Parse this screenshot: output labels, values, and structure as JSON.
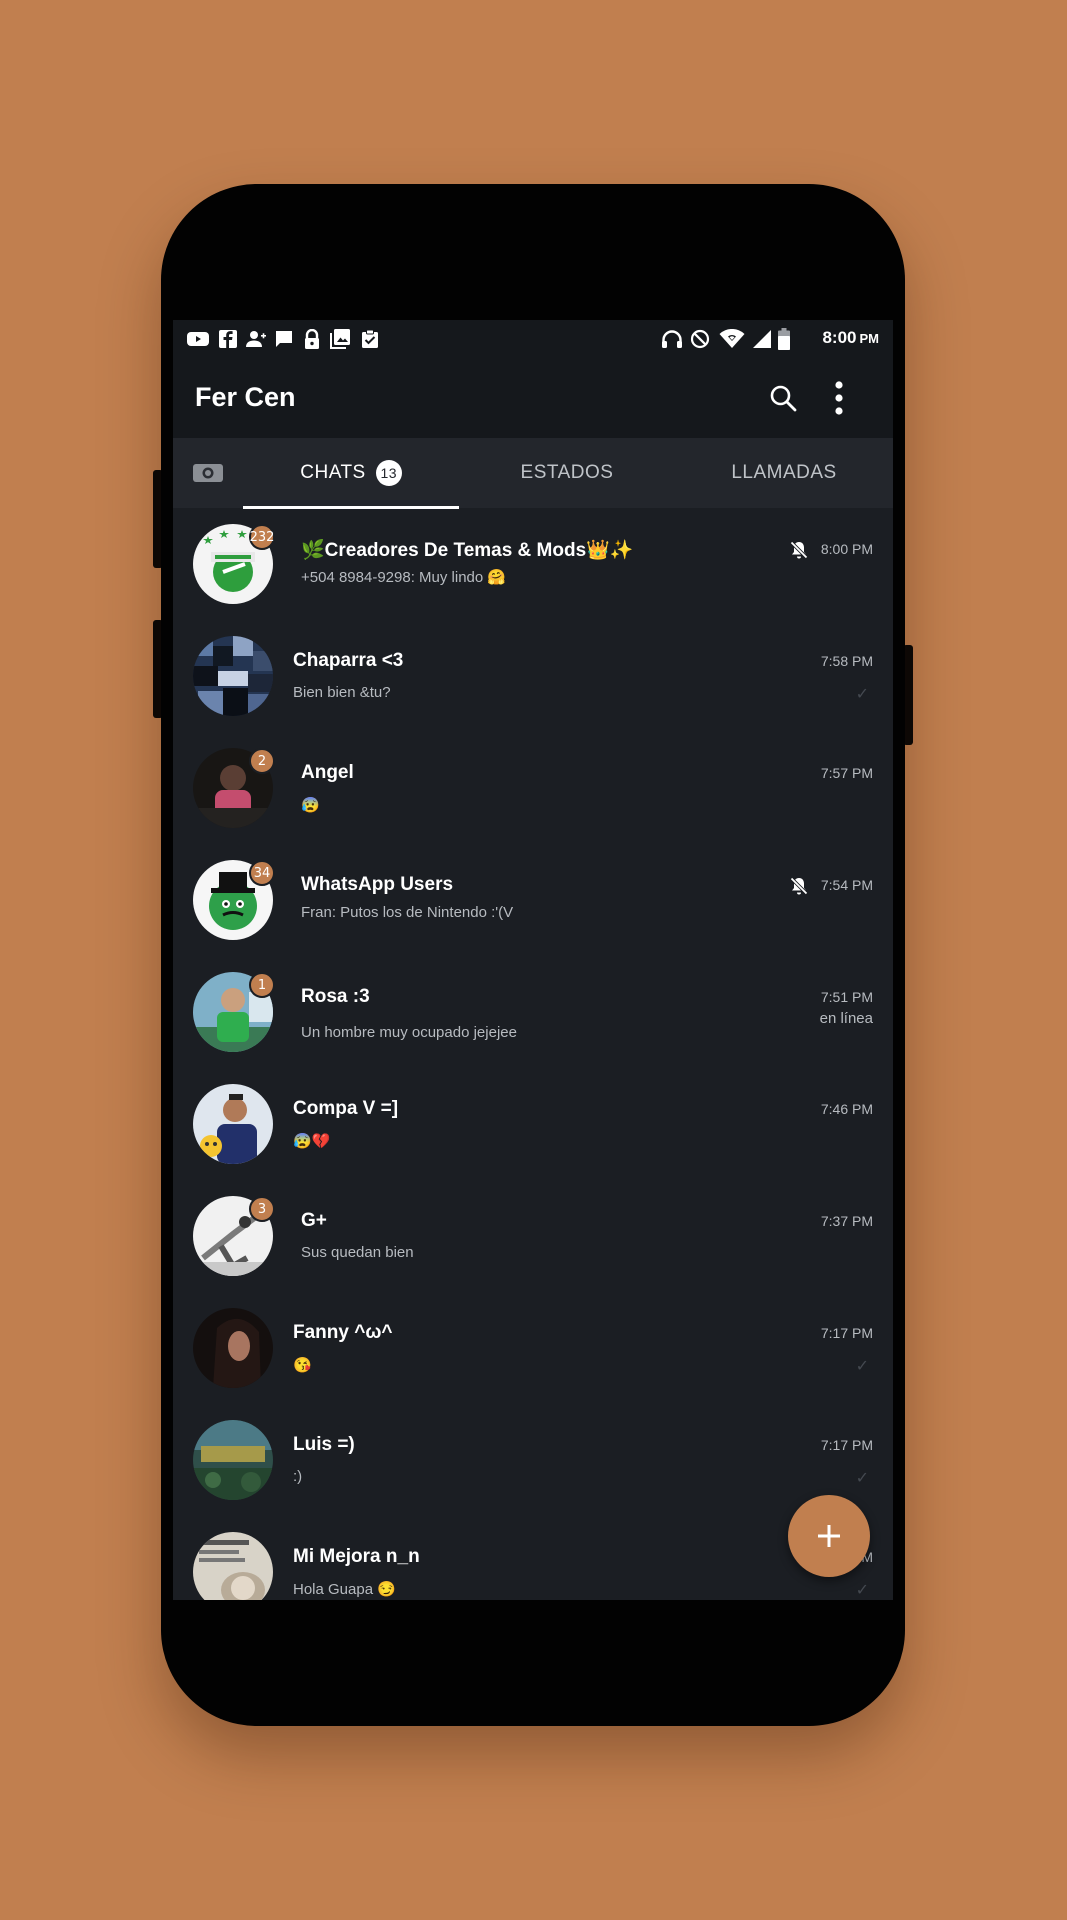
{
  "status_bar": {
    "left_icons": [
      "youtube-icon",
      "facebook-icon",
      "person-add-icon",
      "chat-bubble-icon",
      "lock-icon",
      "gallery-icon",
      "clipboard-check-icon"
    ],
    "right_icons": [
      "headphones-icon",
      "do-not-disturb-icon",
      "wifi-icon",
      "signal-icon",
      "battery-icon"
    ],
    "time": "8:00",
    "time_suffix": "PM"
  },
  "toolbar": {
    "title": "Fer Cen",
    "search_icon": "search-icon",
    "menu_icon": "more-vert-icon"
  },
  "tabs": {
    "camera_icon": "camera-icon",
    "items": [
      {
        "label": "CHATS",
        "count": "13"
      },
      {
        "label": "ESTADOS"
      },
      {
        "label": "LLAMADAS"
      }
    ]
  },
  "chats": [
    {
      "name": "🌿Creadores De Temas & Mods👑✨",
      "message": "+504 8984-9298: Muy lindo 🤗",
      "time": "8:00 PM",
      "badge": "232",
      "muted": true
    },
    {
      "name": "Chaparra <3",
      "message": "Bien bien &tu?",
      "time": "7:58 PM",
      "read": true
    },
    {
      "name": "Angel",
      "message": "😰",
      "time": "7:57 PM",
      "badge": "2"
    },
    {
      "name": "WhatsApp Users",
      "message": "Fran: Putos los de Nintendo :'(V",
      "time": "7:54 PM",
      "badge": "34",
      "muted": true
    },
    {
      "name": "Rosa :3",
      "message": "Un hombre muy ocupado jejejee",
      "time": "7:51 PM",
      "status": "en línea",
      "badge": "1"
    },
    {
      "name": "Compa V =]",
      "message": "😰💔",
      "time": "7:46 PM"
    },
    {
      "name": "G+",
      "message": "Sus quedan bien",
      "time": "7:37 PM",
      "badge": "3"
    },
    {
      "name": "Fanny ^ω^",
      "message": "😘",
      "time": "7:17 PM",
      "read": true
    },
    {
      "name": "Luis =)",
      "message": ":)",
      "time": "7:17 PM",
      "read": true
    },
    {
      "name": "Mi Mejora n_n",
      "message": "Hola Guapa 😏",
      "time": "7:16 PM",
      "read": true
    }
  ],
  "fab": {
    "icon": "plus-icon",
    "color": "#c17f4f"
  },
  "colors": {
    "accent": "#c17f4f",
    "background": "#1b1e23",
    "toolbar": "#15181c",
    "tabs": "#23262c"
  }
}
